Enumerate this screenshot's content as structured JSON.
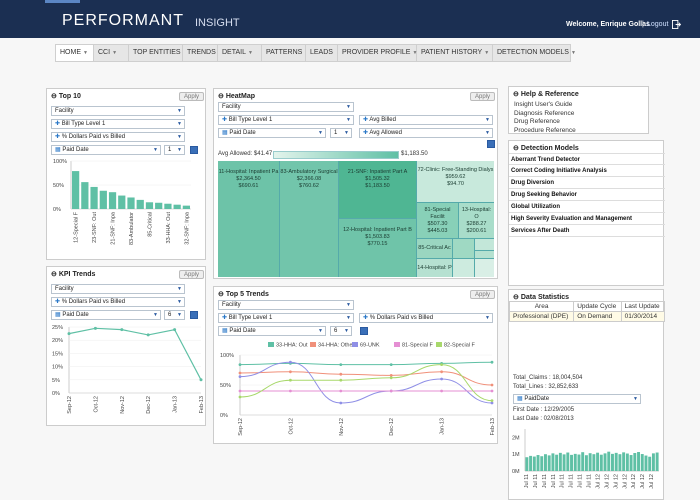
{
  "header": {
    "logo": "PERFORMANT",
    "product": "INSIGHT",
    "welcome": "Welcome, Enrique Gollas",
    "separator": "|",
    "logout": "Logout"
  },
  "nav": [
    {
      "label": "HOME"
    },
    {
      "label": "CCI"
    },
    {
      "label": "TOP ENTITIES"
    },
    {
      "label": "TRENDS"
    },
    {
      "label": "DETAIL"
    },
    {
      "label": "PATTERNS"
    },
    {
      "label": "LEADS"
    },
    {
      "label": "PROVIDER PROFILE"
    },
    {
      "label": "PATIENT HISTORY"
    },
    {
      "label": "DETECTION MODELS"
    }
  ],
  "top10": {
    "title": "Top 10",
    "apply": "Apply",
    "facility": "Facility",
    "bill_type": "Bill Type Level 1",
    "metric": "% Dollars Paid vs Billed",
    "date": "Paid Date",
    "count": "1",
    "yticks": [
      "100%",
      "50%",
      "0%"
    ],
    "xlabels": [
      "12-Special F",
      "23-SNF: Out",
      "21-SNF: Inpa",
      "83-Ambulator",
      "85-Critical",
      "33-HHA: Out",
      "32-SNF: Inpa"
    ],
    "chart_data": {
      "type": "bar",
      "categories": [
        "12-Special F",
        "",
        "23-SNF: Out",
        "",
        "21-SNF: Inpa",
        "",
        "83-Ambulator",
        "",
        "85-Critical",
        "",
        "33-HHA: Out",
        "",
        "32-SNF: Inpa"
      ],
      "values": [
        79,
        56,
        46,
        38,
        35,
        28,
        24,
        19,
        14,
        13,
        11,
        9,
        7
      ],
      "ylim": [
        0,
        100
      ]
    }
  },
  "kpi": {
    "title": "KPI Trends",
    "apply": "Apply",
    "facility": "Facility",
    "metric": "% Dollars Paid vs Billed",
    "date": "Paid Date",
    "count": "6",
    "yticks": [
      "25%",
      "20%",
      "15%",
      "10%",
      "5%",
      "0%"
    ],
    "xlabels": [
      "Sep-12",
      "Oct-12",
      "Nov-12",
      "Dec-12",
      "Jan-13",
      "Feb-13"
    ],
    "chart_data": {
      "type": "line",
      "x": [
        "Sep-12",
        "Oct-12",
        "Nov-12",
        "Dec-12",
        "Jan-13",
        "Feb-13"
      ],
      "values": [
        22.5,
        24.5,
        24.0,
        22.0,
        24.0,
        5.0
      ],
      "ylim": [
        0,
        27
      ]
    }
  },
  "heatmap": {
    "title": "HeatMap",
    "apply": "Apply",
    "facility": "Facility",
    "bill_type": "Bill Type Level 1",
    "measure1": "Avg Billed",
    "date": "Paid Date",
    "count": "1",
    "measure2": "Avg Allowed",
    "legend_min": "Avg Allowed: $41.47",
    "legend_max": "$1,183.50",
    "cells": [
      {
        "l1": "11-Hospital: Inpatient Pa",
        "l2": "$2,364.50",
        "l3": "$690.61"
      },
      {
        "l1": "83-Ambulatory Surgical",
        "l2": "$2,366.08",
        "l3": "$760.62"
      },
      {
        "l1": "21-SNF: Inpatient Part A",
        "l2": "$1,505.32",
        "l3": "$1,183.50"
      },
      {
        "l1": "72-Clinic: Free-Standing Dialys",
        "l2": "$959.62",
        "l3": "$94.70"
      },
      {
        "l1": "12-Hospital: Inpatient Part B",
        "l2": "$1,503.83",
        "l3": "$770.15"
      },
      {
        "l1": "81-Special Facilit",
        "l2": "$507.30",
        "l3": "$445.03"
      },
      {
        "l1": "13-Hospital: O",
        "l2": "$288.27",
        "l3": "$200.61"
      },
      {
        "l1": "85-Critical Ac",
        "l2": "",
        "l3": ""
      },
      {
        "l1": "14-Hospital: P",
        "l2": "",
        "l3": ""
      }
    ]
  },
  "top5": {
    "title": "Top 5 Trends",
    "apply": "Apply",
    "facility": "Facility",
    "bill_type": "Bill Type Level 1",
    "metric": "% Dollars Paid vs Billed",
    "date": "Paid Date",
    "count": "6",
    "yticks": [
      "100%",
      "50%",
      "0%"
    ],
    "xlabels": [
      "Sep-12",
      "Oct-12",
      "Nov-12",
      "Dec-12",
      "Jan-13",
      "Feb-13"
    ],
    "chart_data": {
      "type": "line",
      "x": [
        "Sep-12",
        "Oct-12",
        "Nov-12",
        "Dec-12",
        "Jan-13",
        "Feb-13"
      ],
      "ylim": [
        0,
        100
      ],
      "series": [
        {
          "name": "33-HHA: Out",
          "color": "#5fc0a5",
          "values": [
            84,
            86,
            84,
            84,
            86,
            88
          ]
        },
        {
          "name": "34-HHA: Othe",
          "color": "#f0907a",
          "values": [
            70,
            72,
            68,
            66,
            72,
            50
          ]
        },
        {
          "name": "69-UNK",
          "color": "#8f8fe6",
          "values": [
            64,
            88,
            20,
            40,
            60,
            20
          ]
        },
        {
          "name": "81-Special F",
          "color": "#e58fd3",
          "values": [
            40,
            40,
            40,
            40,
            40,
            40
          ]
        },
        {
          "name": "82-Special F",
          "color": "#a8d86b",
          "values": [
            30,
            58,
            58,
            62,
            84,
            24
          ]
        }
      ]
    }
  },
  "help": {
    "title": "Help & Reference",
    "links": [
      "Insight User's Guide",
      "Diagnosis Reference",
      "Drug Reference",
      "Procedure Reference"
    ]
  },
  "detection": {
    "title": "Detection Models",
    "items": [
      "Aberrant Trend Detector",
      "Correct Coding Initiative Analysis",
      "Drug Diversion",
      "Drug Seeking Behavior",
      "Global Utilization",
      "High Severity Evaluation and Management",
      "Services After Death"
    ]
  },
  "datastats": {
    "title": "Data Statistics",
    "headers": [
      "Area",
      "Update Cycle",
      "Last Update"
    ],
    "row": [
      "Professional (DPE)",
      "On Demand",
      "01/30/2014"
    ],
    "total_claims": "Total_Claims : 18,004,504",
    "total_lines": "Total_Lines : 32,852,633",
    "date_field": "PaidDate",
    "first_date": "First Date : 12/29/2005",
    "last_date": "Last Date : 02/08/2013",
    "yticks": [
      "2M",
      "1M",
      "0M"
    ],
    "xlabels": [
      "Jul 11",
      "Jul 11",
      "Jul 11",
      "Jul 11",
      "Jul 11",
      "Jul 11",
      "Jul 11",
      "Jul 11",
      "Jul 12",
      "Jul 12",
      "Jul 12",
      "Jul 12",
      "Jul 12",
      "Jul 12",
      "Jul 12"
    ],
    "chart_data": {
      "type": "bar",
      "values": [
        0.82,
        0.9,
        0.86,
        0.95,
        0.88,
        1.0,
        0.93,
        1.05,
        0.97,
        1.08,
        0.99,
        1.1,
        0.96,
        1.02,
        0.98,
        1.12,
        0.94,
        1.06,
        1.0,
        1.09,
        0.97,
        1.05,
        1.15,
        1.02,
        1.08,
        1.0,
        1.11,
        1.04,
        0.95,
        1.07,
        1.13,
        1.01,
        0.92,
        0.85,
        1.05,
        1.1
      ],
      "ylim": [
        0,
        2.5
      ]
    }
  },
  "colors": {
    "header_bg": "#1b2f52",
    "bar": "#5fc0a5",
    "link": "#2a5aa0"
  }
}
